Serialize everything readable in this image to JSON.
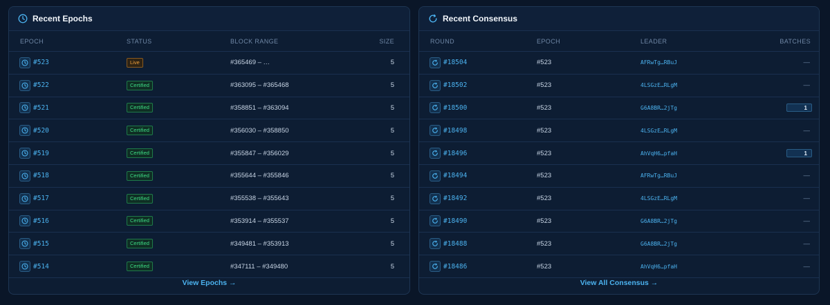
{
  "epochs_panel": {
    "title": "Recent Epochs",
    "columns": {
      "epoch": "EPOCH",
      "status": "STATUS",
      "block_range": "BLOCK RANGE",
      "size": "SIZE"
    },
    "rows": [
      {
        "epoch": "#523",
        "status": "Live",
        "status_type": "live",
        "block_range": "#365469 – …",
        "size": "5"
      },
      {
        "epoch": "#522",
        "status": "Certified",
        "status_type": "certified",
        "block_range": "#363095 – #365468",
        "size": "5"
      },
      {
        "epoch": "#521",
        "status": "Certified",
        "status_type": "certified",
        "block_range": "#358851 – #363094",
        "size": "5"
      },
      {
        "epoch": "#520",
        "status": "Certified",
        "status_type": "certified",
        "block_range": "#356030 – #358850",
        "size": "5"
      },
      {
        "epoch": "#519",
        "status": "Certified",
        "status_type": "certified",
        "block_range": "#355847 – #356029",
        "size": "5"
      },
      {
        "epoch": "#518",
        "status": "Certified",
        "status_type": "certified",
        "block_range": "#355644 – #355846",
        "size": "5"
      },
      {
        "epoch": "#517",
        "status": "Certified",
        "status_type": "certified",
        "block_range": "#355538 – #355643",
        "size": "5"
      },
      {
        "epoch": "#516",
        "status": "Certified",
        "status_type": "certified",
        "block_range": "#353914 – #355537",
        "size": "5"
      },
      {
        "epoch": "#515",
        "status": "Certified",
        "status_type": "certified",
        "block_range": "#349481 – #353913",
        "size": "5"
      },
      {
        "epoch": "#514",
        "status": "Certified",
        "status_type": "certified",
        "block_range": "#347111 – #349480",
        "size": "5"
      }
    ],
    "footer_link": "View Epochs →"
  },
  "consensus_panel": {
    "title": "Recent Consensus",
    "columns": {
      "round": "ROUND",
      "epoch": "EPOCH",
      "leader": "LEADER",
      "batches": "BATCHES"
    },
    "rows": [
      {
        "round": "#18504",
        "epoch": "#523",
        "leader": "AFRwTg…RBuJ",
        "batches": "—"
      },
      {
        "round": "#18502",
        "epoch": "#523",
        "leader": "4LSGzE…RLgM",
        "batches": "—"
      },
      {
        "round": "#18500",
        "epoch": "#523",
        "leader": "G6A8BR…2jTg",
        "batches": "1"
      },
      {
        "round": "#18498",
        "epoch": "#523",
        "leader": "4LSGzE…RLgM",
        "batches": "—"
      },
      {
        "round": "#18496",
        "epoch": "#523",
        "leader": "AhVqH6…pfaH",
        "batches": "1"
      },
      {
        "round": "#18494",
        "epoch": "#523",
        "leader": "AFRwTg…RBuJ",
        "batches": "—"
      },
      {
        "round": "#18492",
        "epoch": "#523",
        "leader": "4LSGzE…RLgM",
        "batches": "—"
      },
      {
        "round": "#18490",
        "epoch": "#523",
        "leader": "G6A8BR…2jTg",
        "batches": "—"
      },
      {
        "round": "#18488",
        "epoch": "#523",
        "leader": "G6A8BR…2jTg",
        "batches": "—"
      },
      {
        "round": "#18486",
        "epoch": "#523",
        "leader": "AhVqH6…pfaH",
        "batches": "—"
      }
    ],
    "footer_link": "View All Consensus →"
  },
  "colors": {
    "background": "#0a1628",
    "panel": "#0d1d33",
    "accent": "#4cb3f0",
    "live": "#f0a13c",
    "certified": "#3ddc84"
  }
}
